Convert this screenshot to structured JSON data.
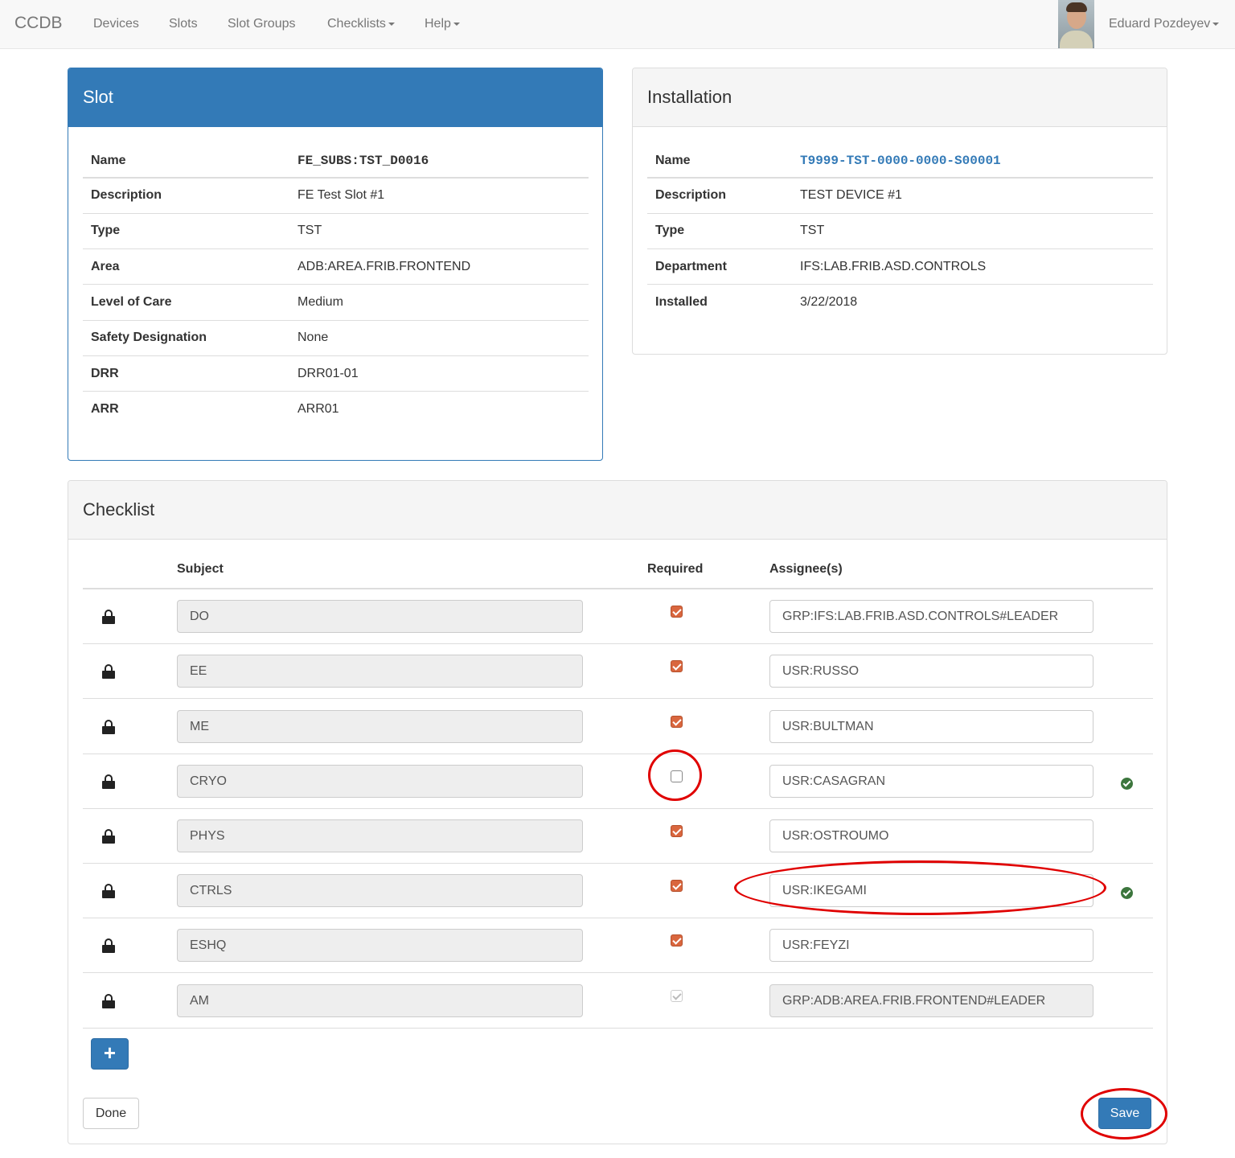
{
  "navbar": {
    "brand": "CCDB",
    "items": [
      "Devices",
      "Slots",
      "Slot Groups",
      "Checklists",
      "Help"
    ],
    "user": "Eduard Pozdeyev"
  },
  "slot": {
    "title": "Slot",
    "rows": [
      {
        "label": "Name",
        "value": "FE_SUBS:TST_D0016"
      },
      {
        "label": "Description",
        "value": "FE Test Slot #1"
      },
      {
        "label": "Type",
        "value": "TST"
      },
      {
        "label": "Area",
        "value": "ADB:AREA.FRIB.FRONTEND"
      },
      {
        "label": "Level of Care",
        "value": "Medium"
      },
      {
        "label": "Safety Designation",
        "value": "None"
      },
      {
        "label": "DRR",
        "value": "DRR01-01"
      },
      {
        "label": "ARR",
        "value": "ARR01"
      }
    ]
  },
  "installation": {
    "title": "Installation",
    "rows": [
      {
        "label": "Name",
        "value": "T9999-TST-0000-0000-S00001"
      },
      {
        "label": "Description",
        "value": "TEST DEVICE #1"
      },
      {
        "label": "Type",
        "value": "TST"
      },
      {
        "label": "Department",
        "value": "IFS:LAB.FRIB.ASD.CONTROLS"
      },
      {
        "label": "Installed",
        "value": "3/22/2018"
      }
    ]
  },
  "checklist": {
    "title": "Checklist",
    "columns": {
      "subject": "Subject",
      "required": "Required",
      "assignees": "Assignee(s)"
    },
    "rows": [
      {
        "subject": "DO",
        "required": true,
        "assignee": "GRP:IFS:LAB.FRIB.ASD.CONTROLS#LEADER",
        "assignee_readonly": false,
        "status_ok": false
      },
      {
        "subject": "EE",
        "required": true,
        "assignee": "USR:RUSSO",
        "assignee_readonly": false,
        "status_ok": false
      },
      {
        "subject": "ME",
        "required": true,
        "assignee": "USR:BULTMAN",
        "assignee_readonly": false,
        "status_ok": false
      },
      {
        "subject": "CRYO",
        "required": false,
        "assignee": "USR:CASAGRAN",
        "assignee_readonly": false,
        "status_ok": true
      },
      {
        "subject": "PHYS",
        "required": true,
        "assignee": "USR:OSTROUMO",
        "assignee_readonly": false,
        "status_ok": false
      },
      {
        "subject": "CTRLS",
        "required": true,
        "assignee": "USR:IKEGAMI",
        "assignee_readonly": false,
        "status_ok": true
      },
      {
        "subject": "ESHQ",
        "required": true,
        "assignee": "USR:FEYZI",
        "assignee_readonly": false,
        "status_ok": false
      },
      {
        "subject": "AM",
        "required": true,
        "required_disabled": true,
        "assignee": "GRP:ADB:AREA.FRIB.FRONTEND#LEADER",
        "assignee_readonly": true,
        "status_ok": false
      }
    ],
    "add_button": "+",
    "done_button": "Done",
    "save_button": "Save"
  },
  "colors": {
    "primary": "#337ab7",
    "checkbox_checked": "#d9663e",
    "success": "#3c763d",
    "annotation": "#e00000"
  },
  "icons": [
    "lock-icon",
    "check-circle-icon",
    "plus-icon",
    "caret-down-icon"
  ]
}
